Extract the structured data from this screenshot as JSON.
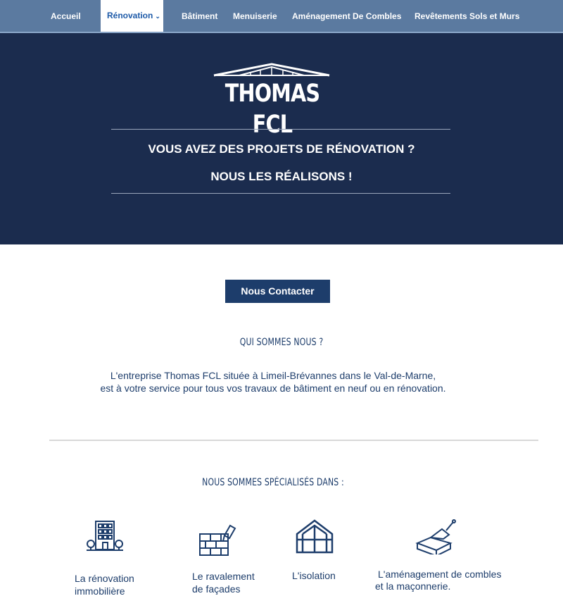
{
  "nav": {
    "items": [
      {
        "label": "Accueil"
      },
      {
        "label": "Rénovation"
      },
      {
        "label": "Bâtiment"
      },
      {
        "label": "Menuiserie"
      },
      {
        "label": "Aménagement De Combles"
      },
      {
        "label": "Revêtements Sols et Murs"
      }
    ],
    "active_index": 1
  },
  "hero": {
    "logo_text": "THOMAS FCL",
    "line1": "VOUS AVEZ DES PROJETS DE RÉNOVATION ?",
    "line2": "NOUS LES RÉALISONS !"
  },
  "contact": {
    "label": "Nous Contacter"
  },
  "about": {
    "title": "QUI SOMMES NOUS ?",
    "line1": "L'entreprise Thomas FCL située à Limeil-Brévannes dans le Val-de-Marne,",
    "line2": "est à votre service pour tous vos travaux de bâtiment en neuf ou en rénovation."
  },
  "specialties": {
    "title": "NOUS SOMMES SPÉCIALISÉS DANS :",
    "items": [
      {
        "icon": "building-icon",
        "line1": "La rénovation",
        "line2": "immobilière"
      },
      {
        "icon": "brick-wall-paint-icon",
        "line1": "Le ravalement",
        "line2": "de façades"
      },
      {
        "icon": "house-frame-icon",
        "line1": "L'isolation",
        "line2": ""
      },
      {
        "icon": "trowel-brick-icon",
        "line1": "L'aménagement de combles",
        "line2": "et la maçonnerie."
      }
    ]
  },
  "colors": {
    "nav_bg": "#5b7aa0",
    "hero_bg": "#1b2c4e",
    "accent": "#1d3d6b"
  }
}
